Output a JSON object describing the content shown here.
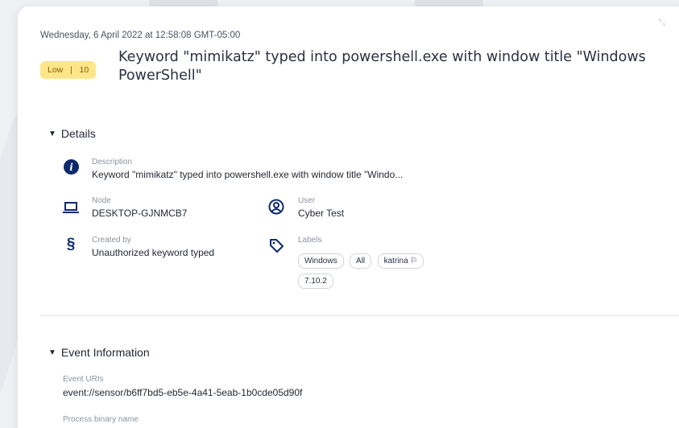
{
  "timestamp": "Wednesday, 6 April 2022 at 12:58:08 GMT-05:00",
  "badge": {
    "severity": "Low",
    "separator": "|",
    "score": "10",
    "color": "#fde68a"
  },
  "title": "Keyword \"mimikatz\" typed into powershell.exe with window title \"Windows PowerShell\"",
  "details": {
    "heading": "Details",
    "description": {
      "label": "Description",
      "value": "Keyword \"mimikatz\" typed into powershell.exe with window title \"Windo..."
    },
    "node": {
      "label": "Node",
      "value": "DESKTOP-GJNMCB7"
    },
    "user": {
      "label": "User",
      "value": "Cyber Test"
    },
    "created_by": {
      "label": "Created by",
      "value": "Unauthorized keyword typed"
    },
    "labels": {
      "label": "Labels",
      "chips": [
        "Windows",
        "All",
        "katrina",
        "7.10.2"
      ]
    }
  },
  "event_info": {
    "heading": "Event Information",
    "uris_label": "Event URIs",
    "uri": "event://sensor/b6ff7bd5-eb5e-4a41-5eab-1b0cde05d90f",
    "process_label": "Process binary name"
  },
  "icons": {
    "description": "info-icon",
    "node": "laptop-icon",
    "user": "user-circle-icon",
    "created_by": "section-sign-icon",
    "labels": "tags-icon",
    "flag": "flag-icon"
  }
}
